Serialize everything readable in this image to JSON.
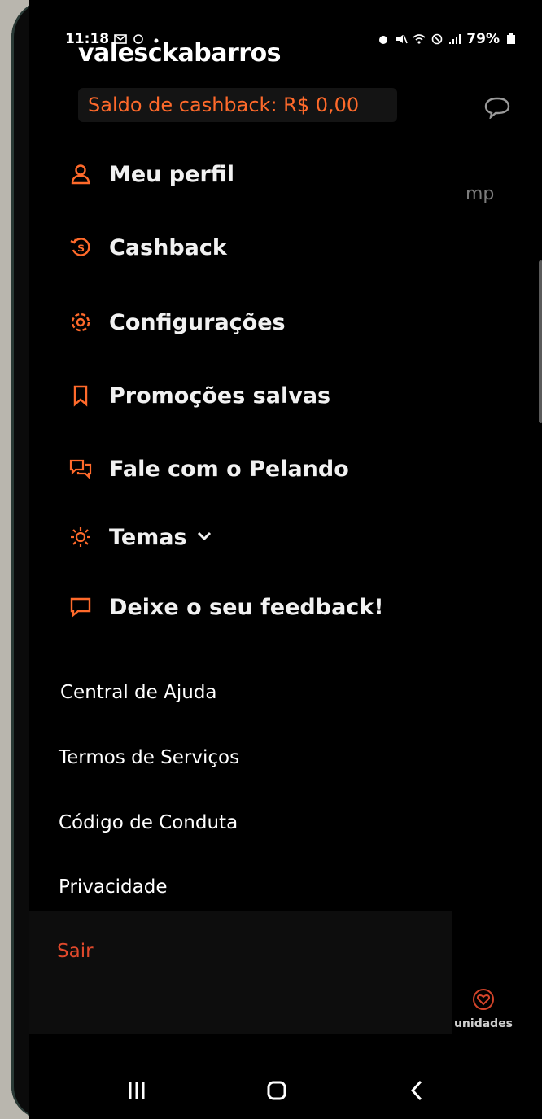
{
  "status_bar": {
    "time": "11:18",
    "battery": "79%"
  },
  "profile": {
    "username": "valesckabarros"
  },
  "cashback_banner": {
    "text": "Saldo de cashback: R$ 0,00"
  },
  "background_text": "mp",
  "menu": [
    {
      "label": "Meu perfil",
      "icon": "person-icon"
    },
    {
      "label": "Cashback",
      "icon": "cashback-coin-icon"
    },
    {
      "label": "Configurações",
      "icon": "gear-icon"
    },
    {
      "label": "Promoções salvas",
      "icon": "bookmark-icon"
    },
    {
      "label": "Fale com o Pelando",
      "icon": "chat-bubbles-icon"
    },
    {
      "label": "Temas",
      "icon": "sun-icon"
    },
    {
      "label": "Deixe o seu feedback!",
      "icon": "feedback-icon"
    }
  ],
  "help": {
    "title": "Central de Ajuda",
    "links": [
      "Termos de Serviços",
      "Código de Conduta",
      "Privacidade"
    ]
  },
  "logout_label": "Sair",
  "unidades_label": "unidades",
  "colors": {
    "accent": "#ff6a2b",
    "logout": "#e0492c",
    "background": "#000000",
    "text": "#f1f1f1"
  }
}
